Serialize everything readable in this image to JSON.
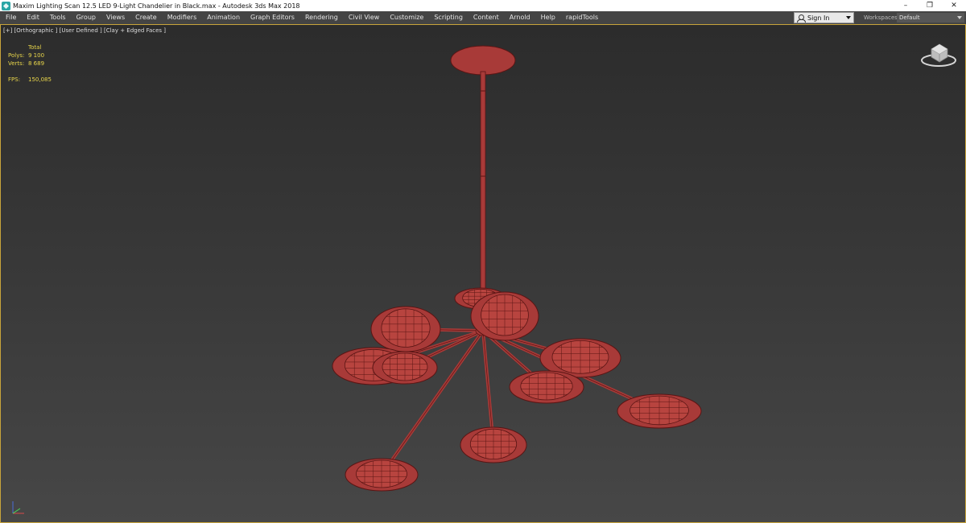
{
  "window": {
    "title": "Maxim Lighting Scan 12.5 LED 9-Light Chandelier in Black.max - Autodesk 3ds Max 2018",
    "controls": {
      "minimize": "–",
      "maximize": "❐",
      "close": "✕"
    }
  },
  "menu": {
    "items": [
      "File",
      "Edit",
      "Tools",
      "Group",
      "Views",
      "Create",
      "Modifiers",
      "Animation",
      "Graph Editors",
      "Rendering",
      "Civil View",
      "Customize",
      "Scripting",
      "Content",
      "Arnold",
      "Help",
      "rapidTools"
    ],
    "sign_in": "Sign In",
    "workspaces_label": "Workspaces:",
    "workspaces_value": "Default"
  },
  "viewport": {
    "label": "[+] [Orthographic ] [User Defined ] [Clay + Edged Faces ]",
    "stats": {
      "header": "Total",
      "polys_label": "Polys:",
      "polys_value": "9 100",
      "verts_label": "Verts:",
      "verts_value": "8 689",
      "fps_label": "FPS:",
      "fps_value": "150,085"
    },
    "model_color": "#a83a38",
    "wire_color": "#5a1514",
    "border_color": "#c8a43b"
  }
}
